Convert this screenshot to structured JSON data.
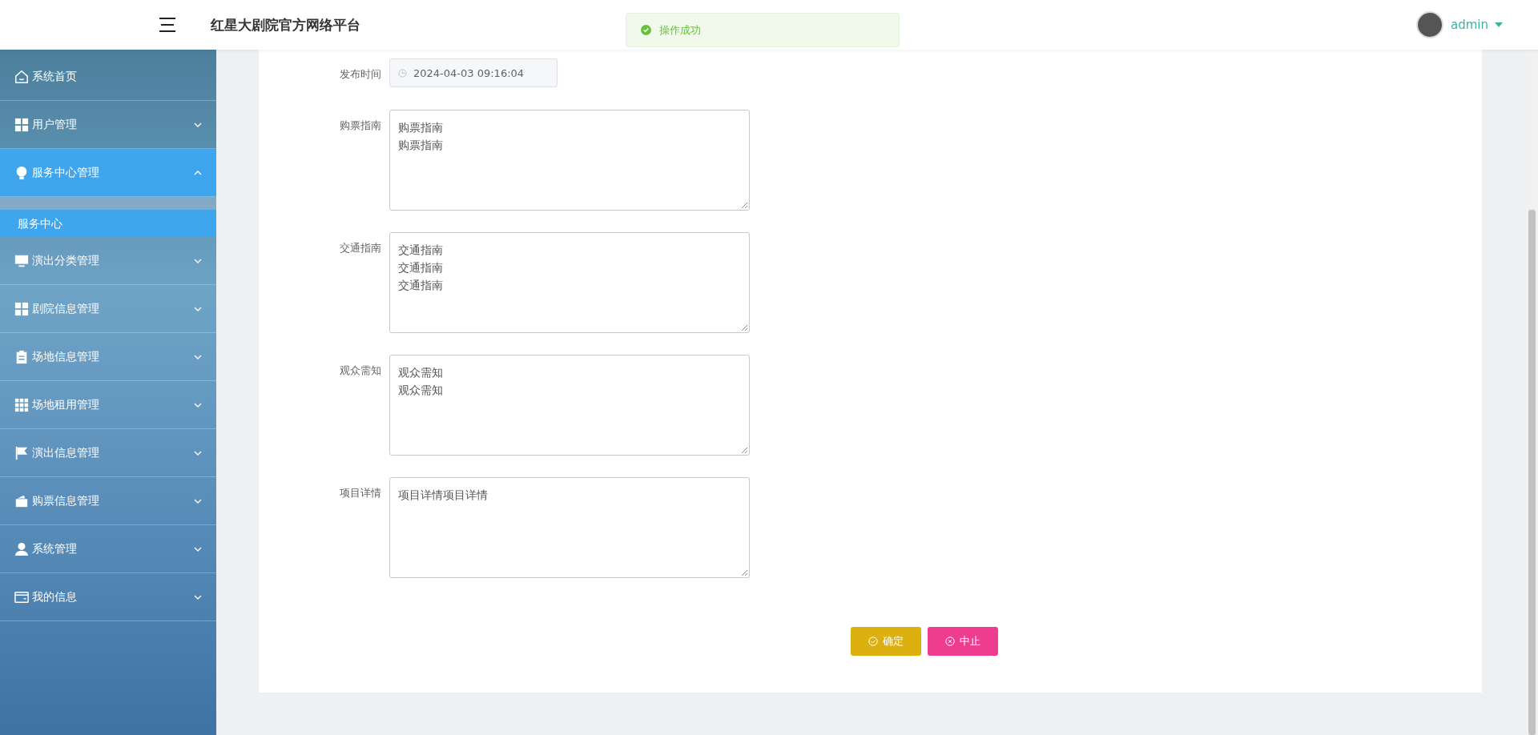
{
  "header": {
    "title": "红星大剧院官方网络平台",
    "user": {
      "name": "admin"
    }
  },
  "toast": {
    "message": "操作成功"
  },
  "sidebar": {
    "items": [
      {
        "label": "系统首页",
        "selected": false
      },
      {
        "label": "用户管理",
        "selected": false,
        "expanded": false
      },
      {
        "label": "服务中心管理",
        "selected": true,
        "expanded": true,
        "children": [
          {
            "label": "服务中心",
            "selected": true
          }
        ]
      },
      {
        "label": "演出分类管理",
        "selected": false,
        "expanded": false
      },
      {
        "label": "剧院信息管理",
        "selected": false,
        "expanded": false
      },
      {
        "label": "场地信息管理",
        "selected": false,
        "expanded": false
      },
      {
        "label": "场地租用管理",
        "selected": false,
        "expanded": false
      },
      {
        "label": "演出信息管理",
        "selected": false,
        "expanded": false
      },
      {
        "label": "购票信息管理",
        "selected": false,
        "expanded": false
      },
      {
        "label": "系统管理",
        "selected": false,
        "expanded": false
      },
      {
        "label": "我的信息",
        "selected": false,
        "expanded": false
      }
    ]
  },
  "form": {
    "fields": [
      {
        "kind": "datetime",
        "label": "发布时间",
        "value": "2024-04-03 09:16:04",
        "disabled": true
      },
      {
        "kind": "textarea",
        "label": "购票指南",
        "lines": [
          "购票指南",
          "购票指南"
        ]
      },
      {
        "kind": "textarea",
        "label": "交通指南",
        "lines": [
          "交通指南",
          "交通指南",
          "交通指南"
        ]
      },
      {
        "kind": "textarea",
        "label": "观众需知",
        "lines": [
          "观众需知",
          "观众需知"
        ]
      },
      {
        "kind": "textarea",
        "label": "项目详情",
        "lines": [
          "项目详情项目详情"
        ]
      }
    ],
    "buttons": [
      {
        "kind": "confirm",
        "label": "确定"
      },
      {
        "kind": "cancel",
        "label": "中止"
      }
    ]
  }
}
